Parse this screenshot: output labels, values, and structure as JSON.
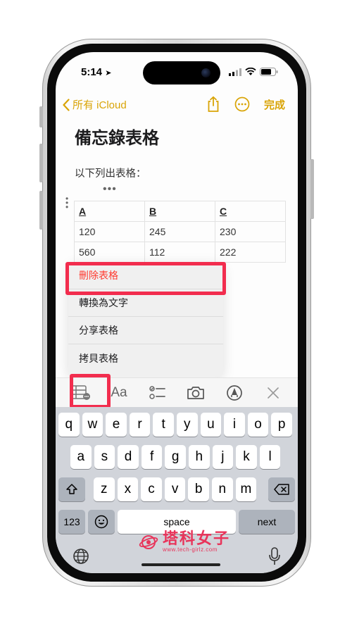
{
  "status_bar": {
    "time": "5:14"
  },
  "nav": {
    "back_label": "所有 iCloud",
    "done_label": "完成"
  },
  "note": {
    "title": "備忘錄表格",
    "body": "以下列出表格：",
    "table": {
      "rows": [
        [
          "A",
          "B",
          "C"
        ],
        [
          "120",
          "245",
          "230"
        ],
        [
          "560",
          "112",
          "222"
        ]
      ]
    }
  },
  "context_menu": {
    "items": [
      "刪除表格",
      "轉換為文字",
      "分享表格",
      "拷貝表格"
    ]
  },
  "toolbar": {
    "icons": [
      "table-icon",
      "text-format-icon",
      "checklist-icon",
      "camera-icon",
      "markup-pen-icon",
      "close-icon"
    ],
    "text_format_label": "Aa"
  },
  "keyboard": {
    "row1": [
      "q",
      "w",
      "e",
      "r",
      "t",
      "y",
      "u",
      "i",
      "o",
      "p"
    ],
    "row2": [
      "a",
      "s",
      "d",
      "f",
      "g",
      "h",
      "j",
      "k",
      "l"
    ],
    "row3": [
      "z",
      "x",
      "c",
      "v",
      "b",
      "n",
      "m"
    ],
    "numbers_label": "123",
    "space_label": "space",
    "next_label": "next"
  },
  "watermark": {
    "title": "塔科女子",
    "url": "www.tech-girlz.com"
  },
  "colors": {
    "accent": "#d9a406",
    "danger": "#ff3b30",
    "highlight": "#f22d4e",
    "keyboard_bg": "#d1d4da"
  }
}
